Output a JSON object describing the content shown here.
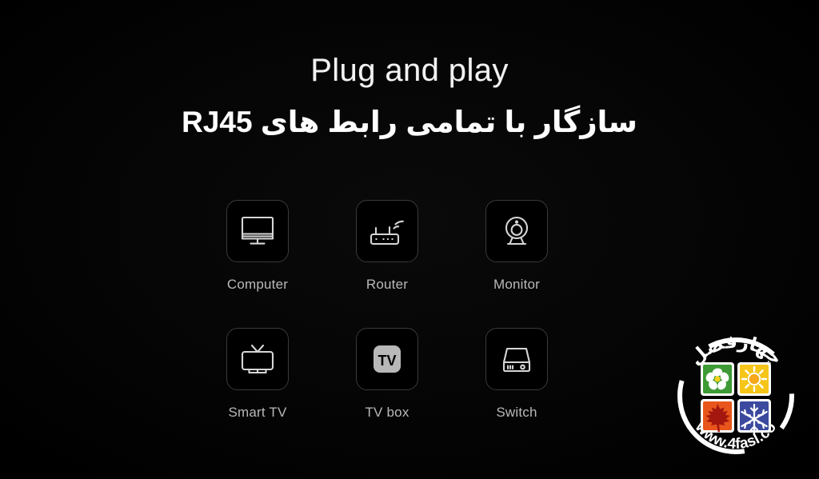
{
  "background_color": "#000000",
  "headings": {
    "title_en": "Plug and play",
    "title_fa": "سازگار با تمامی رابط های RJ45",
    "title_color": "#f2f2f2"
  },
  "devices": [
    {
      "label": "Computer",
      "icon": "desktop-monitor-icon"
    },
    {
      "label": "Router",
      "icon": "wifi-router-icon"
    },
    {
      "label": "Monitor",
      "icon": "webcam-icon"
    },
    {
      "label": "Smart TV",
      "icon": "television-icon"
    },
    {
      "label": "TV box",
      "icon": "tv-box-icon"
    },
    {
      "label": "Switch",
      "icon": "network-switch-icon"
    }
  ],
  "tile_border_color": "#3a3a3a",
  "icon_color": "#d6d6d6",
  "label_color": "#b9b9b9",
  "logo": {
    "name_fa": "چهارفصل",
    "website": "www.4fasl.co",
    "ring_color": "#ffffff",
    "seasons": [
      {
        "name": "spring",
        "symbol": "flower",
        "color": "#3d9a35"
      },
      {
        "name": "summer",
        "symbol": "sun",
        "color": "#f5c518"
      },
      {
        "name": "autumn",
        "symbol": "maple-leaf",
        "color": "#e8561c"
      },
      {
        "name": "winter",
        "symbol": "snowflake",
        "color": "#3b4a9e"
      }
    ]
  }
}
